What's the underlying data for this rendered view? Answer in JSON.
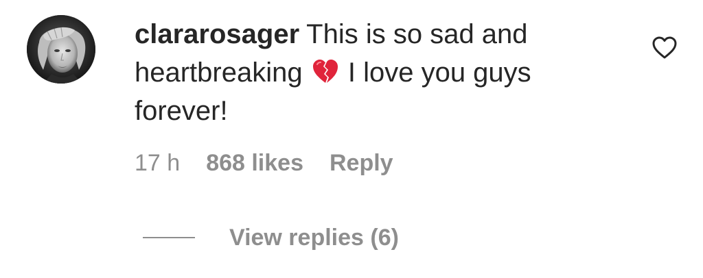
{
  "comment": {
    "username": "clararosager",
    "text_before_emoji": "This is so sad and heartbreaking",
    "emoji": "broken-heart-emoji",
    "text_after_emoji": "I love you guys forever!",
    "time": "17 h",
    "likes": "868 likes",
    "reply_label": "Reply",
    "view_replies_label": "View replies (6)"
  },
  "colors": {
    "text": "#262626",
    "secondary": "#8e8e8e",
    "emoji_red": "#e0243b"
  },
  "icons": {
    "like": "heart-outline-icon",
    "avatar": "profile-photo"
  }
}
